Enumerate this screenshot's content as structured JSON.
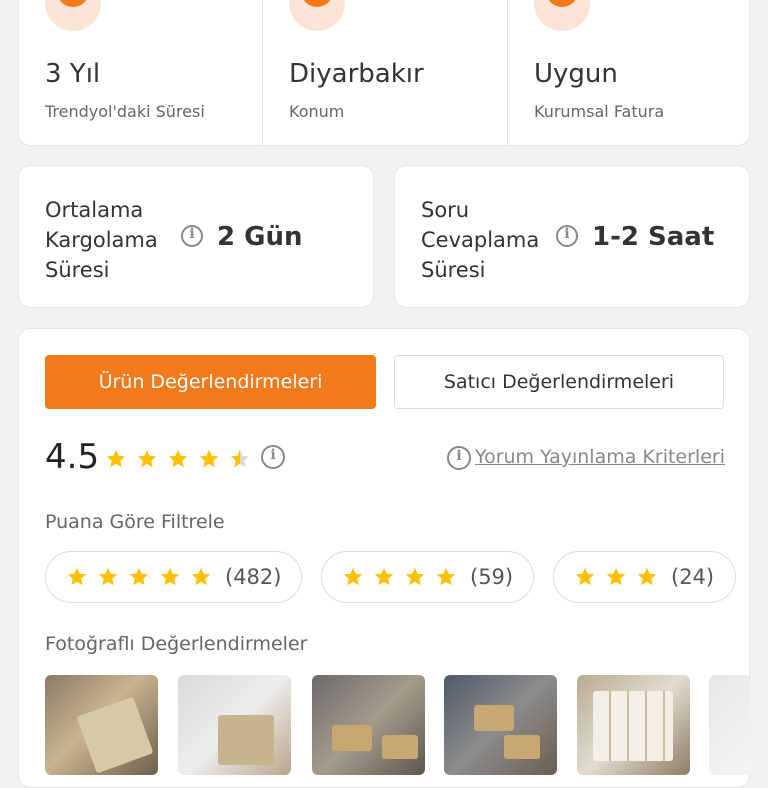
{
  "info": [
    {
      "value": "3 Yıl",
      "label": "Trendyol'daki Süresi",
      "icon": "clock-icon"
    },
    {
      "value": "Diyarbakır",
      "label": "Konum",
      "icon": "location-pin-icon"
    },
    {
      "value": "Uygun",
      "label": "Kurumsal Fatura",
      "icon": "invoice-icon"
    }
  ],
  "stats": {
    "shipping": {
      "label_lines": [
        "Ortalama",
        "Kargolama",
        "Süresi"
      ],
      "value": "2 Gün"
    },
    "answer": {
      "label_lines": [
        "Soru",
        "Cevaplama",
        "Süresi"
      ],
      "value": "1-2 Saat"
    }
  },
  "reviews": {
    "tabs": {
      "product": "Ürün Değerlendirmeleri",
      "seller": "Satıcı Değerlendirmeleri"
    },
    "active_tab": "product",
    "rating": {
      "score": "4.5",
      "stars": 4.5
    },
    "criteria_link": "Yorum Yayınlama Kriterleri",
    "filter_title": "Puana Göre Filtrele",
    "filters": [
      {
        "stars": 5,
        "count": "(482)"
      },
      {
        "stars": 4,
        "count": "(59)"
      },
      {
        "stars": 3,
        "count": "(24)"
      }
    ],
    "photos_title": "Fotoğraflı Değerlendirmeler",
    "photos": [
      "photo-1",
      "photo-2",
      "photo-3",
      "photo-4",
      "photo-5",
      "photo-6"
    ]
  },
  "colors": {
    "accent": "#f27a1a",
    "accent_light": "#fbe4d5",
    "star": "#ffc000",
    "star_empty": "#d9d9d9"
  }
}
